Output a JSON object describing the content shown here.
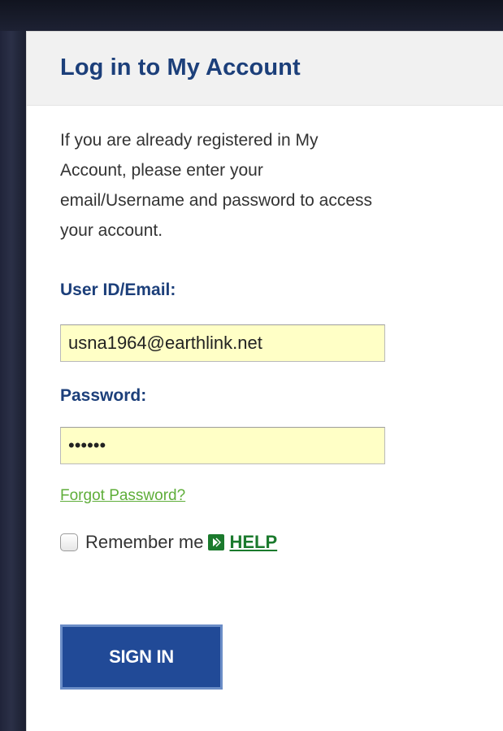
{
  "login_panel": {
    "title": "Log in to My Account",
    "intro_lines": [
      "If you are already registered in My",
      "Account, please enter your",
      "email/Username and password to access",
      "your account."
    ],
    "user_id": {
      "label": "User ID/Email:",
      "value": "usna1964@earthlink.net"
    },
    "password": {
      "label": "Password:",
      "value": "••••••"
    },
    "forgot_password_link": "Forgot Password?",
    "remember_me": {
      "label": "Remember me",
      "checked": false
    },
    "help_link": "HELP",
    "help_arrow_icon": "green-arrow-icon",
    "sign_in_button": "SIGN IN"
  },
  "colors": {
    "title_blue": "#1c3f7a",
    "input_background": "#ffffc6",
    "link_green": "#5fae3a",
    "help_green": "#1b7a2d",
    "button_blue": "#214a97"
  }
}
